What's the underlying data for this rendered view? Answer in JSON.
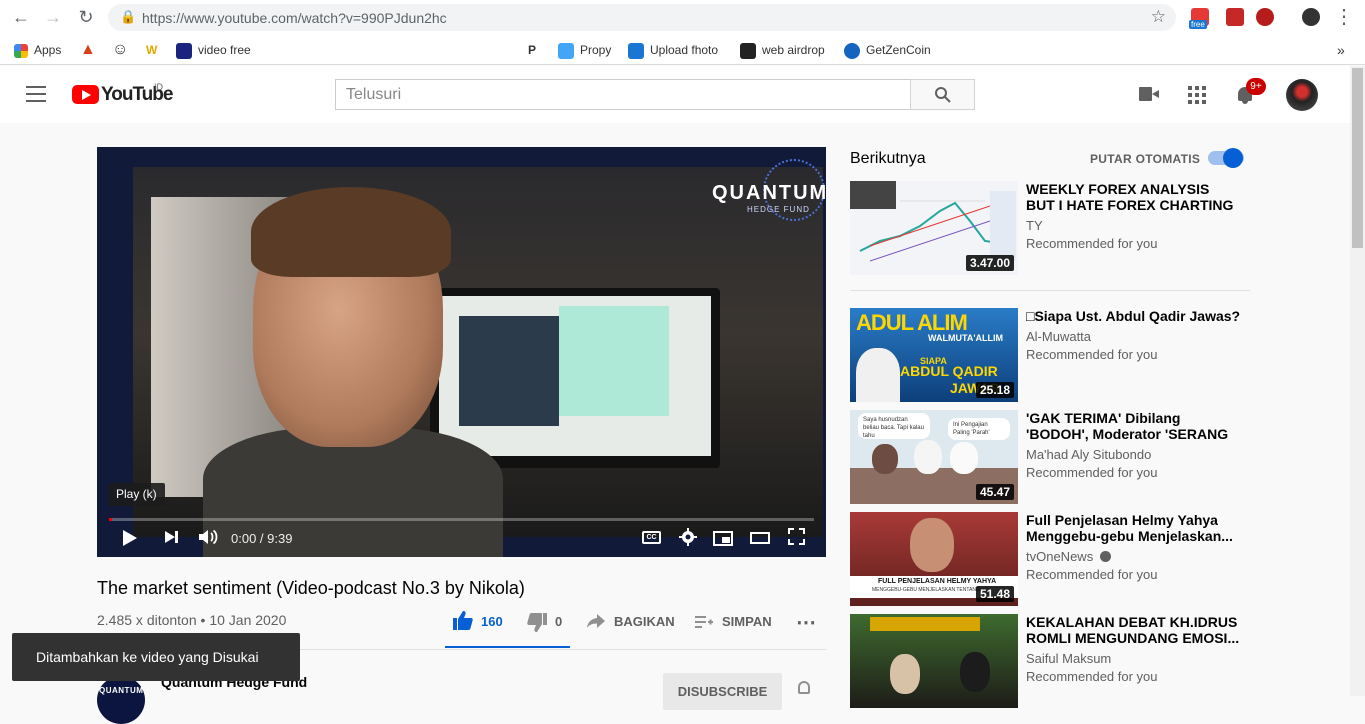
{
  "browser": {
    "url": "https://www.youtube.com/watch?v=990PJdun2hc",
    "bookmarks": [
      "Apps",
      "video free",
      "Propy",
      "Upload fhoto",
      "web airdrop",
      "GetZenCoin"
    ],
    "ext_badge": "free"
  },
  "header": {
    "logo_text": "YouTube",
    "region": "ID",
    "search_placeholder": "Telusuri",
    "notification_count": "9+"
  },
  "player": {
    "overlay_brand": "QUANTUM",
    "overlay_sub": "HEDGE FUND",
    "tooltip": "Play (k)",
    "time": "0:00 / 9:39",
    "progress": 0.0
  },
  "video": {
    "title": "The market sentiment (Video-podcast No.3 by Nikola)",
    "meta": "2.485 x ditonton • 10 Jan 2020",
    "likes": "160",
    "dislikes": "0",
    "share_label": "BAGIKAN",
    "save_label": "SIMPAN",
    "channel_name": "Quantum Hedge Fund",
    "subscribe_label": "DISUBSCRIBE",
    "avatar_text": "QUANTUM"
  },
  "toast": {
    "text": "Ditambahkan ke video yang Disukai"
  },
  "sidebar": {
    "up_next": "Berikutnya",
    "autoplay_label": "PUTAR OTOMATIS",
    "autoplay_on": true,
    "items": [
      {
        "title": "WEEKLY FOREX ANALYSIS BUT I HATE FOREX CHARTING SO I...",
        "channel": "TY",
        "meta": "Recommended for you",
        "duration": "3.47.00",
        "thumb_color": "#f2f4f7"
      },
      {
        "title": "□Siapa Ust. Abdul Qadir Jawas?",
        "channel": "Al-Muwatta",
        "meta": "Recommended for you",
        "duration": "25.18",
        "thumb_color": "#1a5fa8",
        "thumb_text_1": "ADUL ALIM",
        "thumb_text_2": "WALMUTA'ALLIM",
        "thumb_text_3": "ABDUL QADIR",
        "thumb_text_4": "JAWAS",
        "thumb_text_5": "SIAPA"
      },
      {
        "title": "'GAK TERIMA' Dibilang 'BODOH', Moderator 'SERANG BALIK'...",
        "channel": "Ma'had Aly Situbondo",
        "meta": "Recommended for you",
        "duration": "45.47",
        "thumb_color": "#d9e7ee",
        "thumb_text_1": "Saya husnudzan beliau baca. Tapi kalau tahu",
        "thumb_text_2": "Ini Pengajian Paling 'Parah'"
      },
      {
        "title": "Full Penjelasan Helmy Yahya Menggebu-gebu Menjelaskan...",
        "channel": "tvOneNews",
        "meta": "Recommended for you",
        "duration": "51.48",
        "thumb_color": "#b33a35",
        "thumb_text_1": "FULL PENJELASAN HELMY YAHYA",
        "thumb_text_2": "MENGGEBU-GEBU MENJELASKAN TENTANG..."
      },
      {
        "title": "KEKALAHAN DEBAT KH.IDRUS ROMLI MENGUNDANG EMOSI...",
        "channel": "Saiful Maksum",
        "meta": "Recommended for you",
        "duration": "",
        "thumb_color": "#2d2a24"
      }
    ]
  }
}
